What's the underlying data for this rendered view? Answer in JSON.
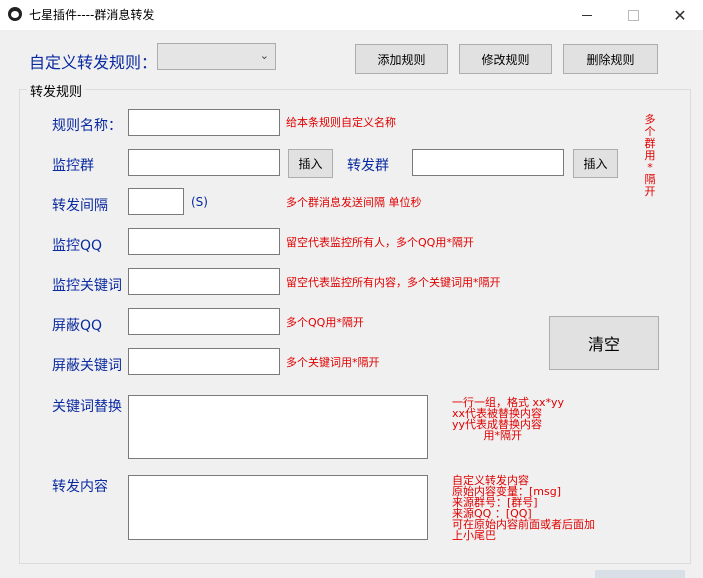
{
  "window": {
    "title": "七星插件----群消息转发",
    "close_glyph": "✕"
  },
  "header": {
    "rule_label": "自定义转发规则：",
    "rule_select_value": "",
    "add_button": "添加规则",
    "edit_button": "修改规则",
    "delete_button": "删除规则"
  },
  "group": {
    "title": "转发规则",
    "rule_name_label": "规则名称：",
    "rule_name_hint": "给本条规则自定义名称",
    "monitor_group_label": "监控群",
    "insert_button_1": "插入",
    "forward_group_label": "转发群",
    "insert_button_2": "插入",
    "side_hint": "多个群用*隔开",
    "interval_label": "转发间隔",
    "interval_unit": "(S)",
    "interval_hint": "多个群消息发送间隔 单位秒",
    "monitor_qq_label": "监控QQ",
    "monitor_qq_hint": "留空代表监控所有人，多个QQ用*隔开",
    "monitor_keyword_label": "监控关键词",
    "monitor_keyword_hint": "留空代表监控所有内容，多个关键词用*隔开",
    "block_qq_label": "屏蔽QQ",
    "block_qq_hint": "多个QQ用*隔开",
    "block_keyword_label": "屏蔽关键词",
    "block_keyword_hint": "多个关键词用*隔开",
    "clear_button": "清空",
    "replace_label": "关键词替换",
    "replace_hint": "一行一组，格式 xx*yy\nxx代表被替换内容\nyy代表成替换内容\n         用*隔开",
    "content_label": "转发内容",
    "content_hint": "自定义转发内容\n原始内容变量：[msg]\n来源群号：[群号]\n来源QQ ：[QQ]\n可在原始内容前面或者后面加\n上小尾巴"
  }
}
